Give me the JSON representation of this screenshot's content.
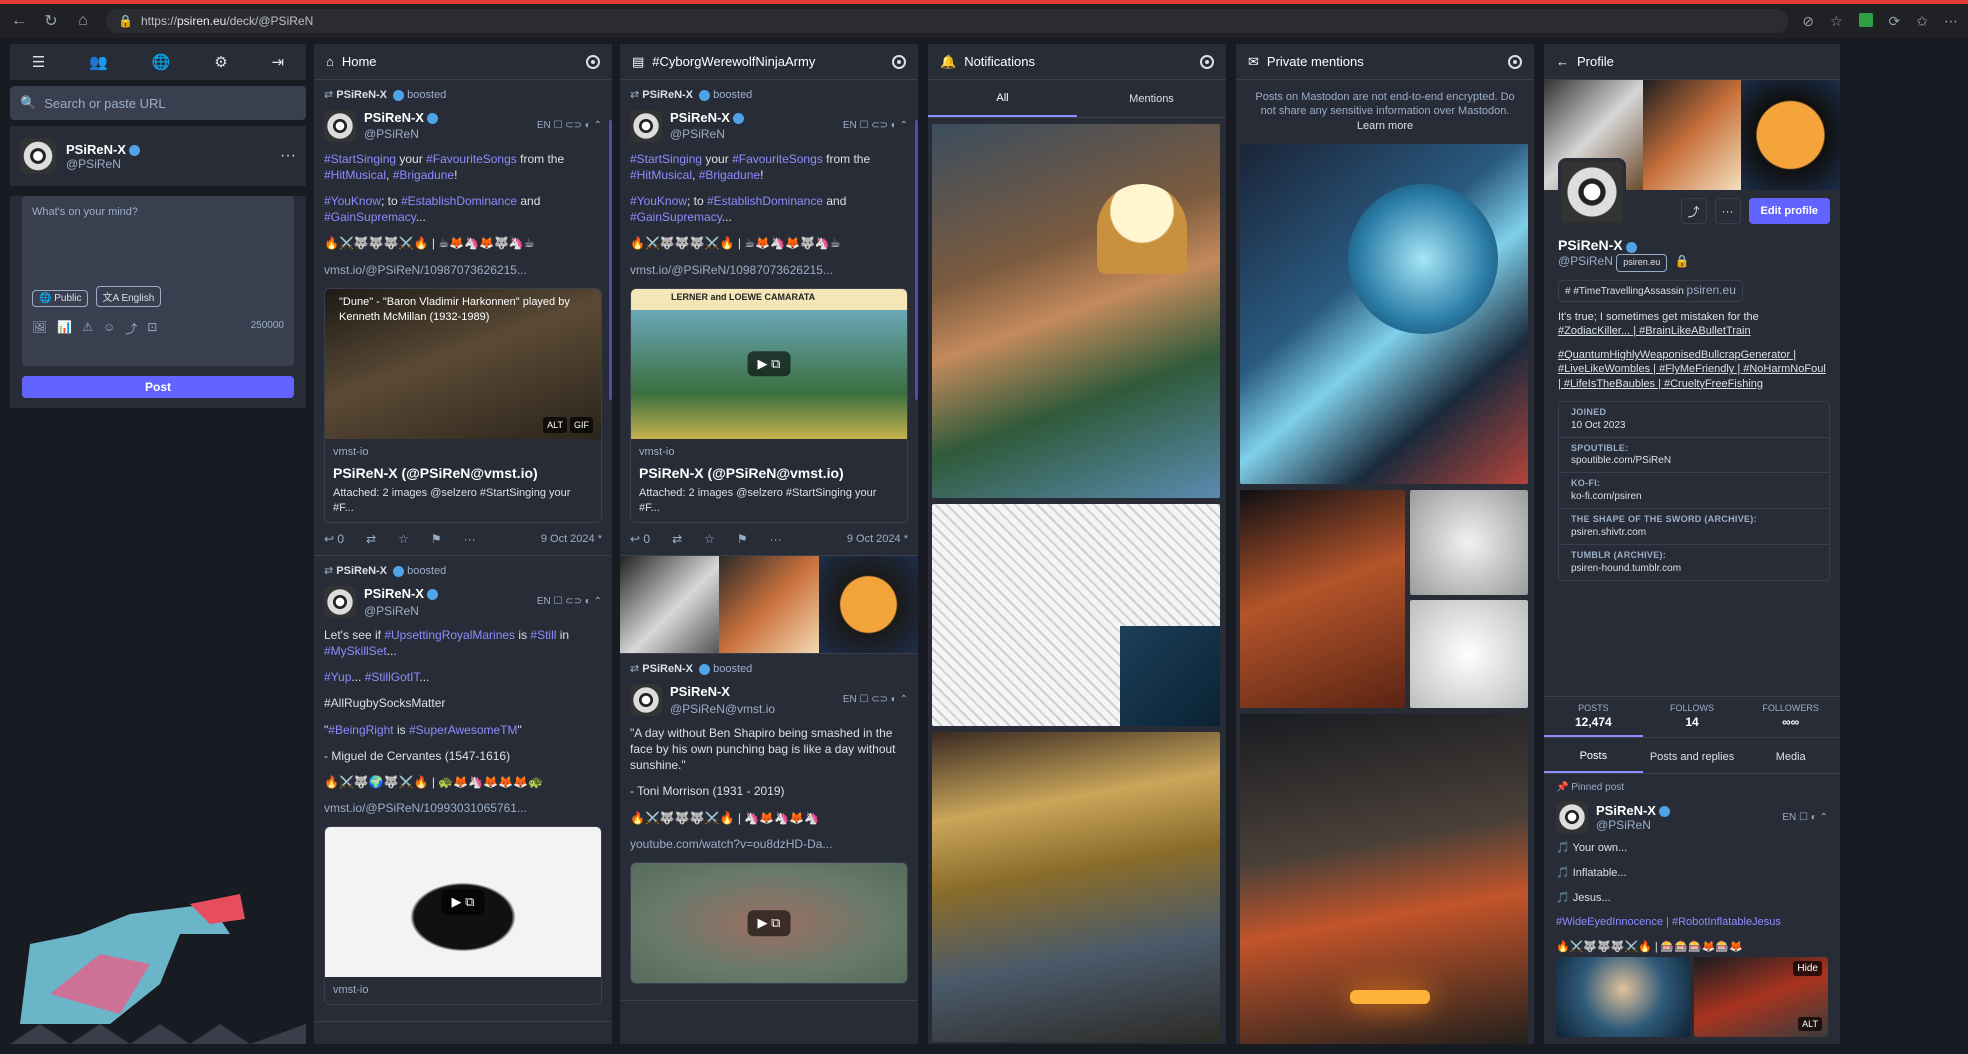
{
  "browser": {
    "url_prefix": "https://",
    "url_host": "psiren.eu",
    "url_path": "/deck/@PSiReN"
  },
  "compose": {
    "search_placeholder": "Search or paste URL",
    "user_name": "PSiReN-X",
    "user_handle": "@PSiReN",
    "menu": "···",
    "textarea_placeholder": "What's on your mind?",
    "visibility": "Public",
    "language": "English",
    "char_count": "250000",
    "post_label": "Post"
  },
  "home": {
    "title": "Home",
    "status1": {
      "booster": "PSiReN-X",
      "boosted": "boosted",
      "name": "PSiReN-X",
      "handle": "@PSiReN",
      "meta": "EN ☐ ⊂⊃ ◐ ⌃",
      "p1_a": "#StartSinging",
      "p1_b": " your ",
      "p1_c": "#FavouriteSongs",
      "p1_d": " from the ",
      "p1_e": "#HitMusical",
      "p1_f": ", ",
      "p1_g": "#Brigadune",
      "p1_h": "!",
      "p2_a": "#YouKnow",
      "p2_b": "; to ",
      "p2_c": "#EstablishDominance",
      "p2_d": " and ",
      "p2_e": "#GainSupremacy",
      "p2_f": "...",
      "emoji": "🔥⚔️🐺🐺🐺⚔️🔥 | ☕🦊🦄🦊🐺🦄☕",
      "link": "vmst.io/@PSiReN/10987073626215...",
      "card_img_caption": "\"Dune\" - \"Baron Vladimir Harkonnen\" played by Kenneth McMillan (1932-1989)",
      "alt": "ALT",
      "gif": "GIF",
      "card_domain": "vmst-io",
      "card_title": "PSiReN-X (@PSiReN@vmst.io)",
      "card_desc": "Attached: 2 images @selzero #StartSinging your #F...",
      "replies": "0",
      "date": "9 Oct 2024 *"
    },
    "status2": {
      "booster": "PSiReN-X",
      "boosted": "boosted",
      "name": "PSiReN-X",
      "handle": "@PSiReN",
      "meta": "EN ☐ ⊂⊃ ◐ ⌃",
      "p1_a": "Let's see if ",
      "p1_b": "#UpsettingRoyalMarines",
      "p1_c": " is ",
      "p1_d": "#Still",
      "p1_e": " in ",
      "p1_f": "#MySkillSet",
      "p1_g": "...",
      "p2_a": "#Yup",
      "p2_b": "... ",
      "p2_c": "#StillGotIT",
      "p2_d": "...",
      "p3": "#AllRugbySocksMatter",
      "p4_a": "\"",
      "p4_b": "#BeingRight",
      "p4_c": " is ",
      "p4_d": "#SuperAwesomeTM",
      "p4_e": "\"",
      "p5": "-  Miguel de Cervantes (1547-1616)",
      "emoji": "🔥⚔️🐺🌍🐺⚔️🔥 | 🐢🦊🦄🦊🦊🦊🐢",
      "link": "vmst.io/@PSiReN/10993031065761...",
      "card_domain": "vmst-io"
    }
  },
  "cyborg": {
    "title": "#CyborgWerewolfNinjaArmy",
    "status1": {
      "booster": "PSiReN-X",
      "boosted": "boosted",
      "name": "PSiReN-X",
      "handle": "@PSiReN",
      "meta": "EN ☐ ⊂⊃ ◐ ⌃",
      "p1_a": "#StartSinging",
      "p1_b": " your ",
      "p1_c": "#FavouriteSongs",
      "p1_d": " from the ",
      "p1_e": "#HitMusical",
      "p1_f": ", ",
      "p1_g": "#Brigadune",
      "p1_h": "!",
      "p2_a": "#YouKnow",
      "p2_b": "; to ",
      "p2_c": "#EstablishDominance",
      "p2_d": " and ",
      "p2_e": "#GainSupremacy",
      "p2_f": "...",
      "emoji": "🔥⚔️🐺🐺🐺⚔️🔥 | ☕🦊🦄🦊🐺🦄☕",
      "link": "vmst.io/@PSiReN/10987073626215...",
      "card_img_header": "LERNER and LOEWE    CAMARATA",
      "card_domain": "vmst-io",
      "card_title": "PSiReN-X (@PSiReN@vmst.io)",
      "card_desc": "Attached: 2 images @selzero #StartSinging your #F...",
      "replies": "0",
      "date": "9 Oct 2024 *"
    },
    "status2": {
      "booster": "PSiReN-X",
      "boosted": "boosted",
      "name": "PSiReN-X",
      "handle": "@PSiReN@vmst.io",
      "meta": "EN ☐ ⊂⊃ ◐ ⌃",
      "p1": "\"A day without Ben Shapiro being smashed in the face by his own punching bag is like a day without sunshine.\"",
      "p2": "- Toni Morrison (1931 - 2019)",
      "emoji": "🔥⚔️🐺🐺🐺⚔️🔥 | 🦄🦊🦄🦊🦄",
      "link": "youtube.com/watch?v=ou8dzHD-Da..."
    }
  },
  "notifications": {
    "title": "Notifications",
    "tab_all": "All",
    "tab_mentions": "Mentions"
  },
  "private": {
    "title": "Private mentions",
    "notice": "Posts on Mastodon are not end-to-end encrypted. Do not share any sensitive information over Mastodon.",
    "learn_more": "Learn more"
  },
  "profile": {
    "title": "Profile",
    "edit": "Edit profile",
    "name": "PSiReN-X",
    "handle": "@PSiReN",
    "domain": "psiren.eu",
    "chip_tag": "#TimeTravellingAssassin",
    "chip_domain": "psiren.eu",
    "bio1": "It's true; I sometimes get mistaken for the",
    "bio1_tags": "#ZodiacKiller... | #BrainLikeABulletTrain",
    "bio2": "#QuantumHighlyWeaponisedBullcrapGenerator | #LiveLikeWombles | #FlyMeFriendly | #NoHarmNoFoul | #LifeIsTheBaubles | #CrueltyFreeFishing",
    "fields": [
      {
        "k": "JOINED",
        "v": "10 Oct 2023"
      },
      {
        "k": "SPOUTIBLE:",
        "v": "spoutible.com/PSiReN"
      },
      {
        "k": "KO-FI:",
        "v": "ko-fi.com/psiren"
      },
      {
        "k": "THE SHAPE OF THE SWORD (ARCHIVE):",
        "v": "psiren.shivtr.com"
      },
      {
        "k": "TUMBLR (ARCHIVE):",
        "v": "psiren-hound.tumblr.com"
      }
    ],
    "stats": {
      "posts_label": "POSTS",
      "posts": "12,474",
      "follows_label": "FOLLOWS",
      "follows": "14",
      "followers_label": "FOLLOWERS",
      "followers": "∞∞"
    },
    "tabs": [
      "Posts",
      "Posts and replies",
      "Media"
    ],
    "pinned_label": "Pinned post",
    "pinned_name": "PSiReN-X",
    "pinned_handle": "@PSiReN",
    "pinned_meta": "EN ☐ ◐ ⌃",
    "pinned_lines": [
      "🎵 Your own...",
      "🎵 Inflatable...",
      "🎵 Jesus..."
    ],
    "pinned_tags": "#WideEyedInnocence | #RobotInflatableJesus",
    "pinned_emoji": "🔥⚔️🐺🐺🐺⚔️🔥 | 🎰🎰🎰🦊🎰🦊",
    "hide": "Hide",
    "alt": "ALT"
  }
}
